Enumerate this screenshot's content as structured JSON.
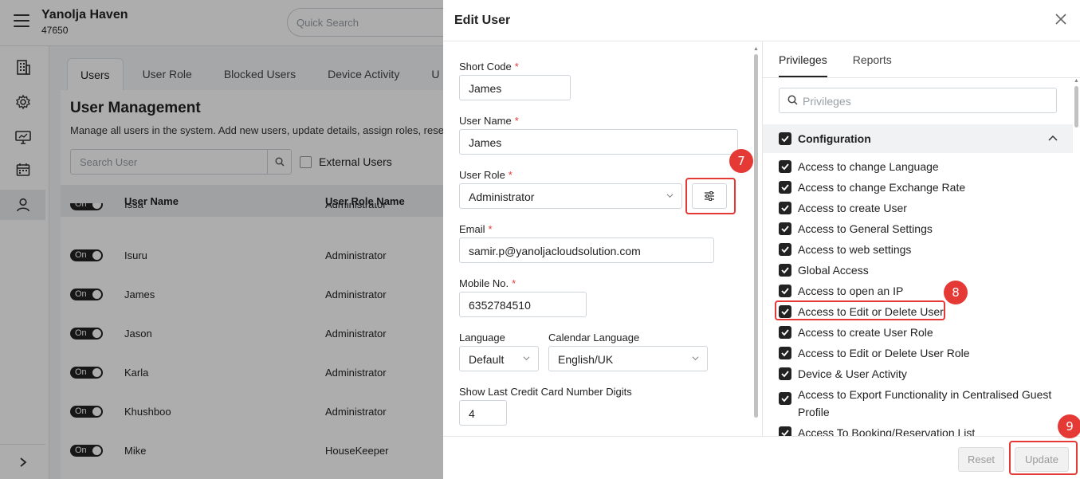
{
  "app": {
    "hotel_name": "Yanolja Haven",
    "hotel_code": "47650",
    "quick_search_placeholder": "Quick Search"
  },
  "background": {
    "tabs": [
      "Users",
      "User Role",
      "Blocked Users",
      "Device Activity",
      "U"
    ],
    "title": "User Management",
    "subtitle": "Manage all users in the system. Add new users, update details, assign roles, reset p",
    "search_placeholder": "Search User",
    "external_users_label": "External Users",
    "columns": [
      "User Name",
      "User Role Name"
    ],
    "rows": [
      {
        "toggle": "On",
        "name": "Issa",
        "role": "Administrator"
      },
      {
        "toggle": "On",
        "name": "Isuru",
        "role": "Administrator"
      },
      {
        "toggle": "On",
        "name": "James",
        "role": "Administrator"
      },
      {
        "toggle": "On",
        "name": "Jason",
        "role": "Administrator"
      },
      {
        "toggle": "On",
        "name": "Karla",
        "role": "Administrator"
      },
      {
        "toggle": "On",
        "name": "Khushboo",
        "role": "Administrator"
      },
      {
        "toggle": "On",
        "name": "Mike",
        "role": "HouseKeeper"
      }
    ]
  },
  "drawer": {
    "title": "Edit User",
    "form": {
      "short_code_label": "Short Code",
      "short_code_value": "James",
      "user_name_label": "User Name",
      "user_name_value": "James",
      "user_role_label": "User Role",
      "user_role_value": "Administrator",
      "email_label": "Email",
      "email_value": "samir.p@yanoljacloudsolution.com",
      "mobile_label": "Mobile No.",
      "mobile_value": "6352784510",
      "language_label": "Language",
      "language_value": "Default",
      "calendar_language_label": "Calendar Language",
      "calendar_language_value": "English/UK",
      "cc_digits_label": "Show Last Credit Card Number Digits",
      "cc_digits_value": "4",
      "required_mark": "*"
    },
    "privileges": {
      "tabs": [
        "Privileges",
        "Reports"
      ],
      "search_placeholder": "Privileges",
      "group": "Configuration",
      "items": [
        "Access to change Language",
        "Access to change Exchange Rate",
        "Access to create User",
        "Access to General Settings",
        "Access to web settings",
        "Global Access",
        "Access to open an IP",
        "Access to Edit or Delete User",
        "Access to create User Role",
        "Access to Edit or Delete User Role",
        "Device & User Activity",
        "Access to Export Functionality in Centralised Guest Profile",
        "Access To Booking/Reservation List"
      ]
    },
    "footer": {
      "reset_label": "Reset",
      "update_label": "Update"
    },
    "annotations": [
      "7",
      "8",
      "9"
    ],
    "annotation_color": "#e53935"
  }
}
